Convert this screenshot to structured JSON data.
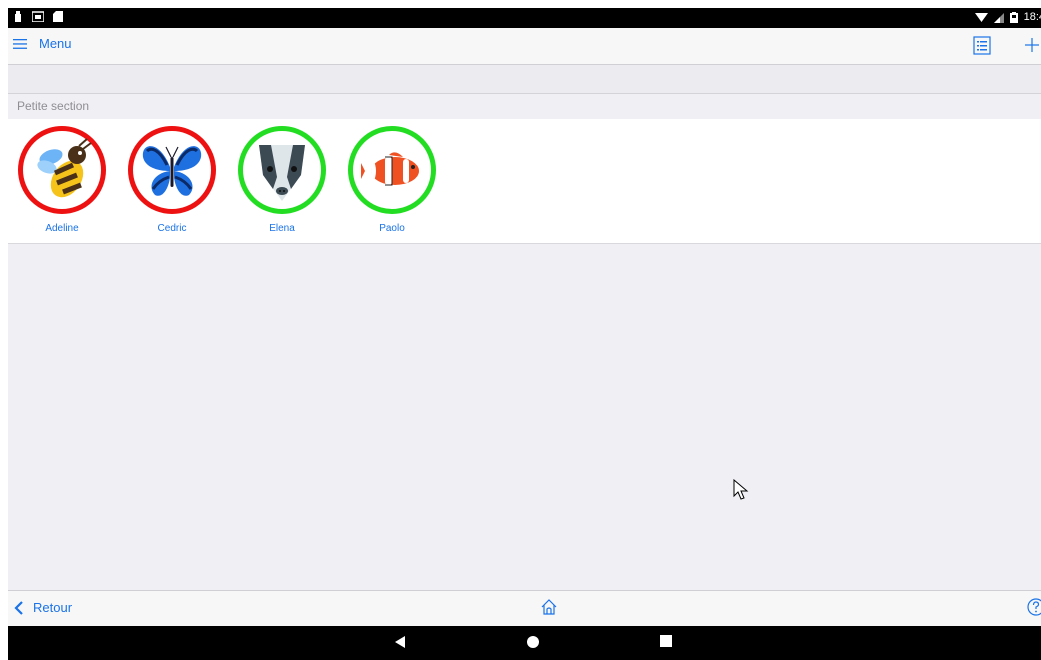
{
  "status_bar": {
    "time": "18:4",
    "icons": [
      "notification-icon",
      "mail-icon",
      "sd-card-icon",
      "wifi-icon",
      "signal-icon",
      "battery-icon"
    ]
  },
  "nav_bar": {
    "menu_label": "Menu",
    "icons": [
      "hamburger-icon",
      "list-view-icon",
      "plus-icon"
    ]
  },
  "section": {
    "title": "Petite section"
  },
  "pupils": [
    {
      "name": "Adeline",
      "avatar": "bee-icon",
      "status_color": "#ee1111"
    },
    {
      "name": "Cedric",
      "avatar": "butterfly-icon",
      "status_color": "#ee1111"
    },
    {
      "name": "Elena",
      "avatar": "badger-icon",
      "status_color": "#22dd22"
    },
    {
      "name": "Paolo",
      "avatar": "clownfish-icon",
      "status_color": "#22dd22"
    }
  ],
  "toolbar": {
    "back_label": "Retour",
    "icons": [
      "chevron-left-icon",
      "home-icon",
      "help-icon"
    ]
  },
  "android_nav": {
    "icons": [
      "back-triangle-icon",
      "home-circle-icon",
      "recents-square-icon"
    ]
  },
  "colors": {
    "accent": "#1a73e8",
    "status_red": "#ee1111",
    "status_green": "#22dd22",
    "background": "#efeff4"
  }
}
